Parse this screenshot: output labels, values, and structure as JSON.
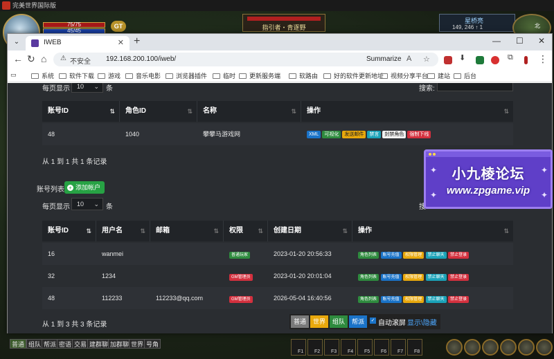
{
  "game": {
    "window_title": "完美世界国际版",
    "hp": "75/75",
    "mp": "45/45",
    "gt_label": "GT",
    "target_name": "指引者・青逐野",
    "map_name": "星桥亮",
    "coordinates": "149, 246 ↑ 1",
    "compass": "北"
  },
  "browser": {
    "tab_title": "IWEB",
    "url_warning": "不安全",
    "url": "192.168.200.100/iweb/",
    "summarize_label": "Summarize",
    "bookmarks": [
      "系统",
      "软件下载",
      "游戏",
      "音乐电影",
      "浏览器插件",
      "临时",
      "更新服务端",
      "软路由",
      "好的软件更新地址",
      "视频分享平台",
      "建站",
      "后台"
    ]
  },
  "roles": {
    "page_size_label_before": "每页显示",
    "page_size": "10",
    "page_size_label_after": "条",
    "search_label": "搜索:",
    "headers": [
      "账号ID",
      "角色ID",
      "名称",
      "操作"
    ],
    "rows": [
      {
        "account_id": "48",
        "role_id": "1040",
        "name": "攀攀马游戏网",
        "actions": [
          "XML",
          "可视化",
          "发送邮件",
          "禁言",
          "封禁角色",
          "强制下线"
        ]
      }
    ],
    "summary": "从 1 到 1 共 1 条记录"
  },
  "accounts": {
    "section_title": "账号列表",
    "add_button": "添加帐户",
    "add_icon": "plus-circle-icon",
    "page_size_label_before": "每页显示",
    "page_size": "10",
    "page_size_label_after": "条",
    "search_label_fragment": "搜",
    "headers": [
      "账号ID",
      "用户名",
      "邮箱",
      "权限",
      "创建日期",
      "操作"
    ],
    "rows": [
      {
        "id": "16",
        "username": "wanmei",
        "email": "",
        "role": "普通玩家",
        "role_color": "#2e8b3e",
        "created": "2023-01-20 20:56:33",
        "actions": [
          "角色列表",
          "账号充值",
          "权限管理",
          "禁止聊天",
          "禁止登录"
        ]
      },
      {
        "id": "32",
        "username": "1234",
        "email": "",
        "role": "GM管理员",
        "role_color": "#d3303e",
        "created": "2023-01-20 20:01:04",
        "actions": [
          "角色列表",
          "账号充值",
          "权限管理",
          "禁止聊天",
          "禁止登录"
        ]
      },
      {
        "id": "48",
        "username": "112233",
        "email": "112233@qq.com",
        "role": "GM管理员",
        "role_color": "#d3303e",
        "created": "2026-05-04 16:40:56",
        "actions": [
          "角色列表",
          "账号充值",
          "权限管理",
          "禁止聊天",
          "禁止登录"
        ]
      }
    ],
    "summary": "从 1 到 3 共 3 条记录"
  },
  "watermark": {
    "line1": "小九棱论坛",
    "line2": "www.zpgame.vip"
  },
  "chat_filter": {
    "buttons": [
      {
        "label": "普通",
        "color": "#7a7a7a"
      },
      {
        "label": "世界",
        "color": "#e8a80c"
      },
      {
        "label": "组队",
        "color": "#2e8b3e"
      },
      {
        "label": "帮派",
        "color": "#1a73c8"
      }
    ],
    "auto_scroll_label": "自动滚屏",
    "toggle_label": "显示\\隐藏"
  },
  "chat_tabs": [
    "普通",
    "组队",
    "帮派",
    "密语",
    "交易",
    "建群聊",
    "加群聊",
    "世界",
    "号角"
  ],
  "hotkeys": [
    "F1",
    "F2",
    "F3",
    "F4",
    "F5",
    "F6",
    "F7",
    "F8"
  ]
}
